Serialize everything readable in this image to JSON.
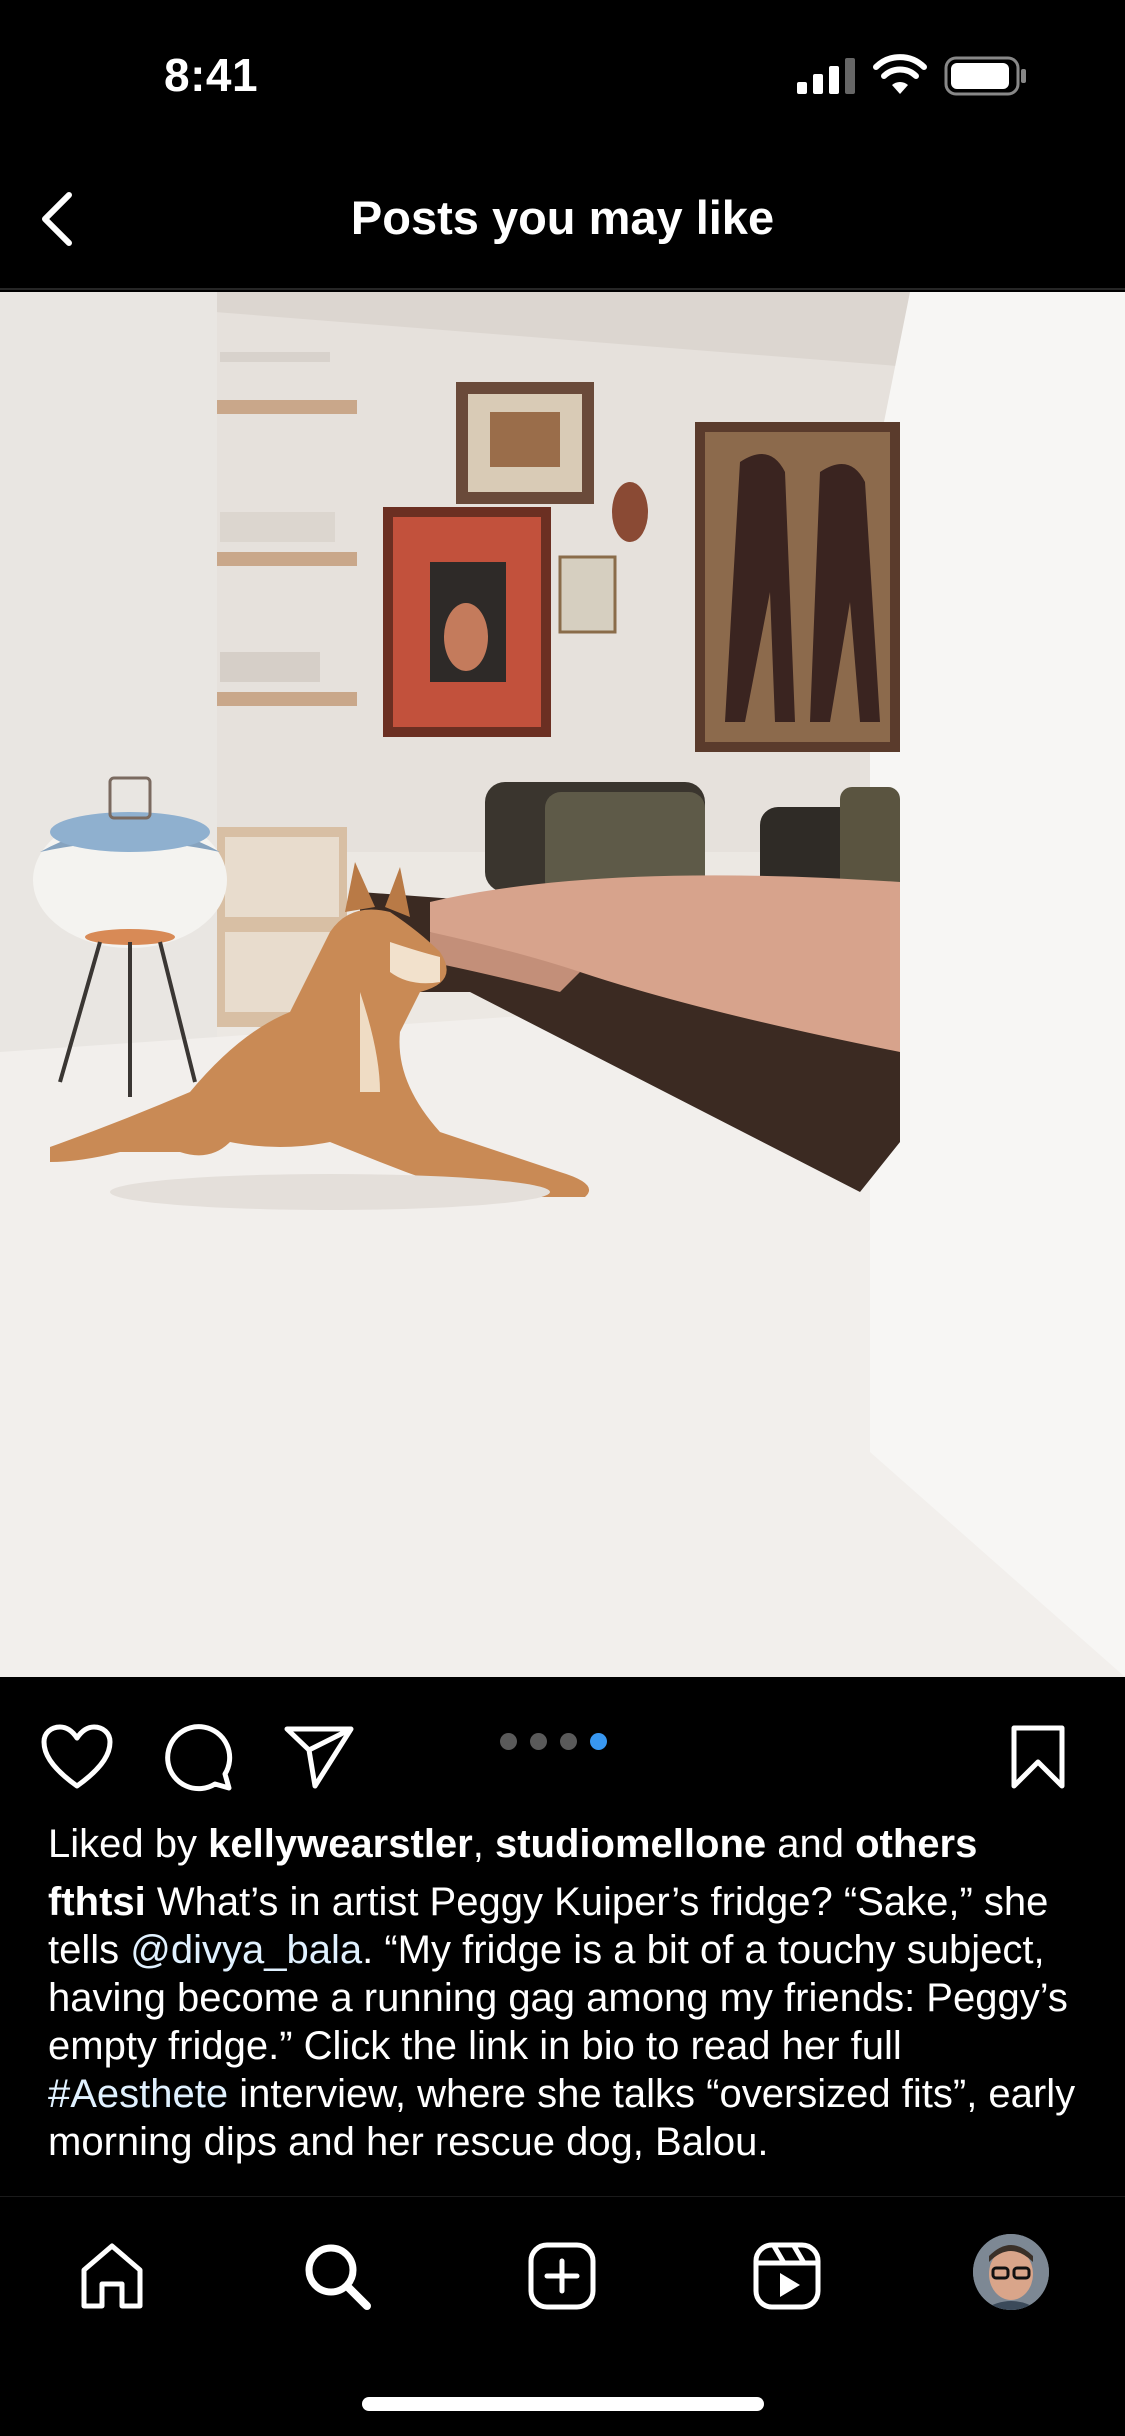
{
  "status_bar": {
    "time": "8:41",
    "signal_icon": "cellular-signal-icon",
    "wifi_icon": "wifi-icon",
    "battery_icon": "battery-icon"
  },
  "header": {
    "back_icon": "chevron-left-icon",
    "title": "Posts you may like"
  },
  "post": {
    "image": {
      "description_icon": "photo"
    },
    "actions": {
      "like_icon": "heart-icon",
      "comment_icon": "comment-icon",
      "share_icon": "send-icon",
      "save_icon": "bookmark-icon"
    },
    "carousel": {
      "total": 4,
      "active_index": 4
    },
    "likes": {
      "prefix": "Liked by ",
      "user1": "kellywearstler",
      "sep": ", ",
      "user2": "studiomellone",
      "and": " and ",
      "others": "others"
    },
    "caption": {
      "username": "fthtsi",
      "part1": " What’s in artist Peggy Kuiper’s fridge? “Sake,” she tells ",
      "mention": "@divya_bala",
      "part2": ". “My fridge is a bit of a touchy subject, having become a running gag among my friends: Peggy’s empty fridge.” Click the link in bio to read her full ",
      "hashtag": "#Aesthete",
      "part3": " interview, where she talks “oversized fits”, early morning dips and her rescue dog, Balou."
    }
  },
  "tab_bar": {
    "items": [
      {
        "icon": "home-icon"
      },
      {
        "icon": "search-icon"
      },
      {
        "icon": "create-post-icon"
      },
      {
        "icon": "reels-icon"
      },
      {
        "icon": "profile-avatar"
      }
    ]
  },
  "colors": {
    "background": "#000000",
    "text": "#ffffff",
    "carousel_active": "#3897f0",
    "carousel_inactive": "#5a5a5a"
  }
}
